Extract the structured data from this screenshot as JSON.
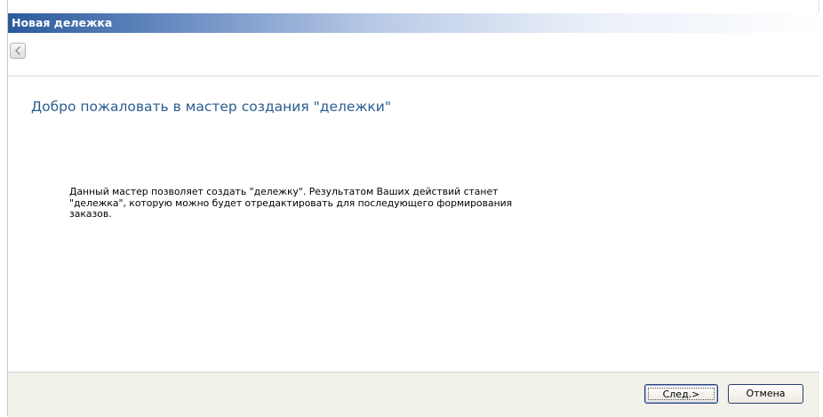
{
  "window": {
    "title": "Новая дележка"
  },
  "nav": {
    "back_icon": "back-arrow-icon"
  },
  "wizard": {
    "heading": "Добро пожаловать в мастер создания \"дележки\"",
    "description_lines": [
      "Данный мастер позволяет создать \"дележку\". Результатом Ваших действий станет",
      "\"дележка\", которую можно будет отредактировать для последующего формирования",
      "заказов."
    ]
  },
  "buttons": {
    "next_label": "След.>",
    "cancel_label": "Отмена"
  },
  "colors": {
    "title_bar": "#2b5a9c",
    "heading_text": "#2b5d8f",
    "footer_background": "#f2f1ea"
  }
}
